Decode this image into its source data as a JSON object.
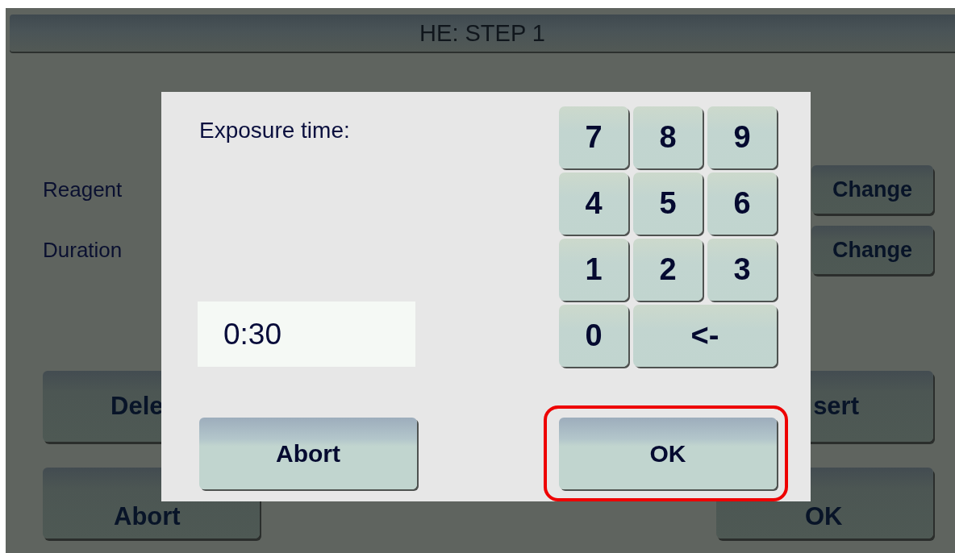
{
  "screen_title": "HE: STEP 1",
  "settings": [
    {
      "label": "Reagent",
      "button": "Change"
    },
    {
      "label": "Duration",
      "button": "Change"
    }
  ],
  "action_rows": [
    {
      "left": "Dele",
      "right": "sert"
    },
    {
      "left": "Abort",
      "right": "OK"
    }
  ],
  "dialog": {
    "label": "Exposure time:",
    "value": "0:30",
    "keys": [
      {
        "label": "7",
        "kind": "digit"
      },
      {
        "label": "8",
        "kind": "digit"
      },
      {
        "label": "9",
        "kind": "digit"
      },
      {
        "label": "4",
        "kind": "digit"
      },
      {
        "label": "5",
        "kind": "digit"
      },
      {
        "label": "6",
        "kind": "digit"
      },
      {
        "label": "1",
        "kind": "digit"
      },
      {
        "label": "2",
        "kind": "digit"
      },
      {
        "label": "3",
        "kind": "digit"
      },
      {
        "label": "0",
        "kind": "digit"
      },
      {
        "label": "<-",
        "kind": "backspace"
      }
    ],
    "buttons": [
      {
        "label": "Abort",
        "highlighted": false
      },
      {
        "label": "OK",
        "highlighted": true
      }
    ]
  }
}
